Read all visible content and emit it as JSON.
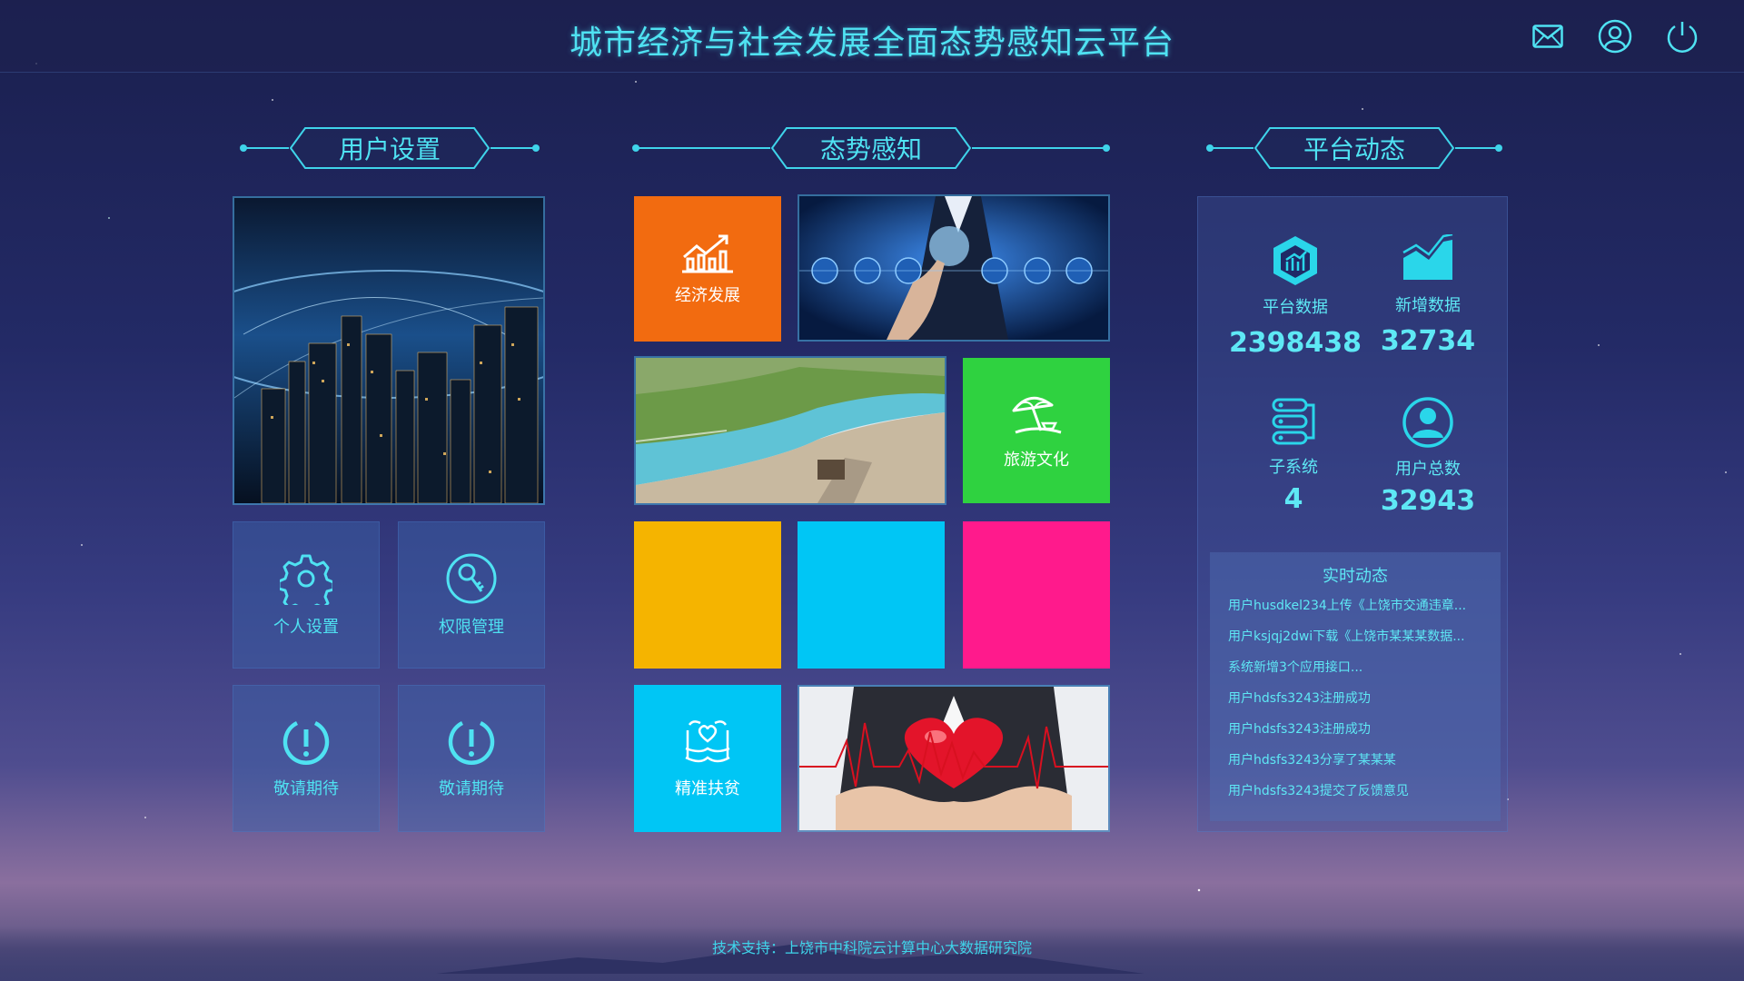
{
  "header": {
    "title": "城市经济与社会发展全面态势感知云平台",
    "icons": [
      "mail-icon",
      "user-icon",
      "power-icon"
    ]
  },
  "sections": {
    "user_settings": "用户设置",
    "situation": "态势感知",
    "platform": "平台动态"
  },
  "user_tiles": [
    {
      "label": "个人设置",
      "icon": "gear-icon"
    },
    {
      "label": "权限管理",
      "icon": "key-icon"
    },
    {
      "label": "敬请期待",
      "icon": "exclamation-icon"
    },
    {
      "label": "敬请期待",
      "icon": "exclamation-icon"
    }
  ],
  "situation_tiles": [
    {
      "label": "经济发展",
      "icon": "chart-icon",
      "color": "#f26b10"
    },
    {
      "label": "旅游文化",
      "icon": "umbrella-icon",
      "color": "#2fd240"
    },
    {
      "label": "",
      "color": "#f5b400"
    },
    {
      "label": "",
      "color": "#00c6f5"
    },
    {
      "label": "",
      "color": "#ff1a8c"
    },
    {
      "label": "精准扶贫",
      "icon": "helping-hands-icon",
      "color": "#00c6f5"
    }
  ],
  "stats": [
    {
      "label": "平台数据",
      "value": "2398438",
      "icon": "cube-chart-icon"
    },
    {
      "label": "新增数据",
      "value": "32734",
      "icon": "area-chart-icon"
    },
    {
      "label": "子系统",
      "value": "4",
      "icon": "server-icon"
    },
    {
      "label": "用户总数",
      "value": "32943",
      "icon": "user-circle-icon"
    }
  ],
  "feed": {
    "title": "实时动态",
    "items": [
      "用户husdkel234上传《上饶市交通违章...",
      "用户ksjqj2dwi下载《上饶市某某某数据...",
      "系统新增3个应用接口...",
      "用户hdsfs3243注册成功",
      "用户hdsfs3243注册成功",
      "用户hdsfs3243分享了某某某",
      "用户hdsfs3243提交了反馈意见"
    ]
  },
  "footer": "技术支持：上饶市中科院云计算中心大数据研究院"
}
